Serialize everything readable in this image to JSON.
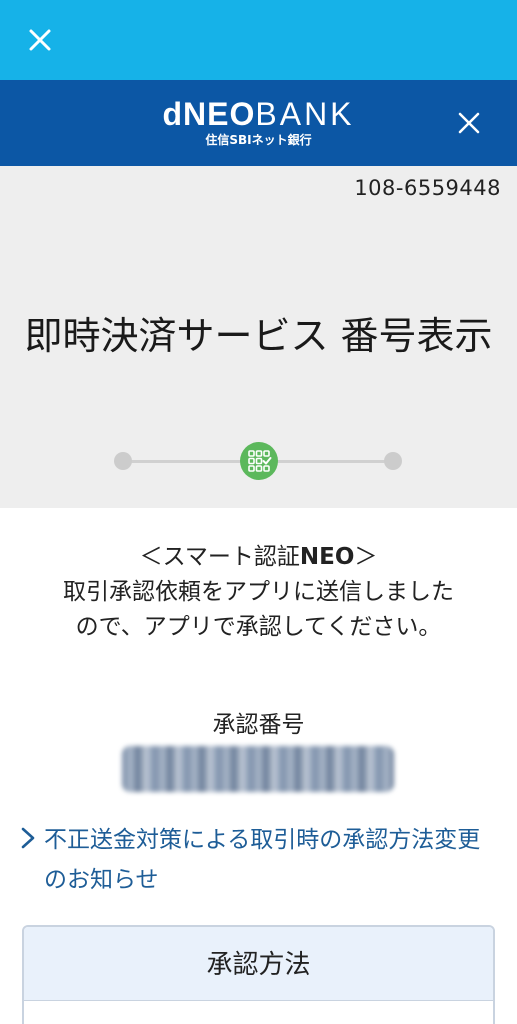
{
  "top_bar": {
    "color": "#16b2e8",
    "close_icon": "close-icon"
  },
  "bank_header": {
    "color": "#0c57a5",
    "logo_main_bold": "dNEO",
    "logo_main_thin": "BANK",
    "logo_sub": "住信SBIネット銀行",
    "close_icon": "close-icon"
  },
  "account_number": "108-6559448",
  "page_title": "即時決済サービス 番号表示",
  "stepper": {
    "steps": 3,
    "current_step": 2,
    "active_icon": "grid-check-icon",
    "active_color": "#5cb85c"
  },
  "notice": {
    "heading_prefix": "＜スマート認証",
    "heading_bold": "NEO",
    "heading_suffix": "＞",
    "line1": "取引承認依頼をアプリに送信しました",
    "line2": "ので、アプリで承認してください。"
  },
  "approval": {
    "label": "承認番号",
    "code": "••••••••"
  },
  "info_link": {
    "text": "不正送金対策による取引時の承認方法変更のお知らせ",
    "icon": "chevron-right-icon",
    "color": "#1e5d97"
  },
  "method_box": {
    "title": "承認方法"
  }
}
